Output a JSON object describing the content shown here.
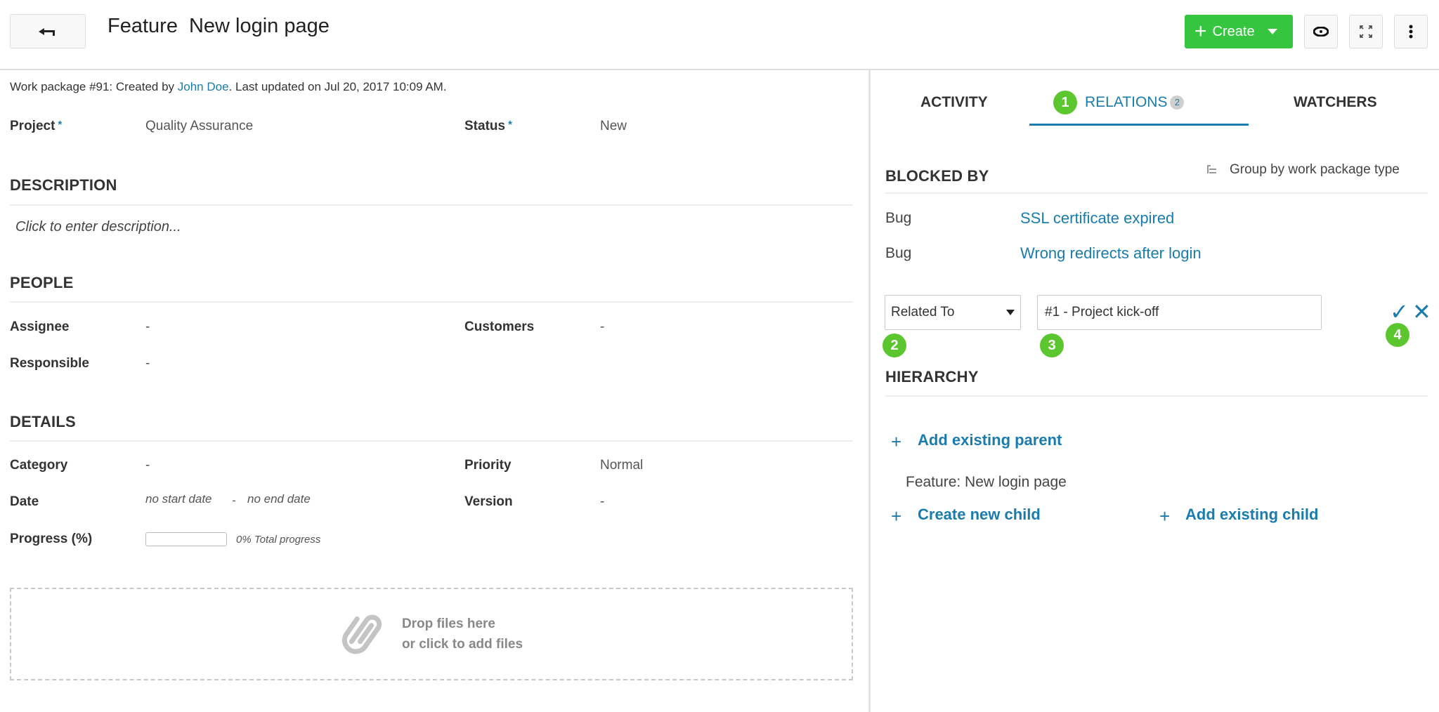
{
  "header": {
    "back_icon": "back-arrow-icon",
    "type": "Feature",
    "subject": "New login page",
    "create_label": "Create",
    "create_plus_icon": "+",
    "actions": [
      {
        "name": "watch",
        "icon": "eye-icon"
      },
      {
        "name": "fullscreen",
        "icon": "expand-icon"
      },
      {
        "name": "more",
        "icon": "more-vertical-icon"
      }
    ]
  },
  "meta": {
    "prefix": "Work package #91: Created by ",
    "author": "John Doe",
    "suffix": ". Last updated on Jul 20, 2017 10:09 AM."
  },
  "overview": {
    "project_label": "Project",
    "project_value": "Quality Assurance",
    "status_label": "Status",
    "status_value": "New",
    "required_mark": "*"
  },
  "description": {
    "title": "DESCRIPTION",
    "placeholder": "Click to enter description..."
  },
  "people": {
    "title": "PEOPLE",
    "assignee_label": "Assignee",
    "assignee_value": "-",
    "customers_label": "Customers",
    "customers_value": "-",
    "responsible_label": "Responsible",
    "responsible_value": "-"
  },
  "details": {
    "title": "DETAILS",
    "category_label": "Category",
    "category_value": "-",
    "priority_label": "Priority",
    "priority_value": "Normal",
    "date_label": "Date",
    "start_date": "no start date",
    "date_sep": "-",
    "end_date": "no end date",
    "version_label": "Version",
    "version_value": "-",
    "progress_label": "Progress (%)",
    "progress_percent": 0,
    "progress_text": "0% Total progress"
  },
  "attachments": {
    "line1": "Drop files here",
    "line2": "or click to add files"
  },
  "tabs": [
    {
      "label": "ACTIVITY",
      "active": false
    },
    {
      "label": "RELATIONS",
      "active": true,
      "count": "2"
    },
    {
      "label": "WATCHERS",
      "active": false
    }
  ],
  "relations": {
    "blocked_by_title": "BLOCKED BY",
    "group_by_label": "Group by work package type",
    "items": [
      {
        "type": "Bug",
        "subject": "SSL certificate expired"
      },
      {
        "type": "Bug",
        "subject": "Wrong redirects after login"
      }
    ],
    "new_relation": {
      "type_selected": "Related To",
      "target_value": "#1 - Project kick-off",
      "confirm_icon": "✓",
      "cancel_icon": "✕"
    }
  },
  "hierarchy": {
    "title": "HIERARCHY",
    "add_parent_label": "Add existing parent",
    "current": "Feature: New login page",
    "create_child_label": "Create new child",
    "add_child_label": "Add existing child",
    "plus": "+"
  },
  "step_markers": [
    "1",
    "2",
    "3",
    "4"
  ],
  "colors": {
    "accent": "#1a7cad",
    "create_green": "#35c53f",
    "step_green": "#5cc62e"
  }
}
